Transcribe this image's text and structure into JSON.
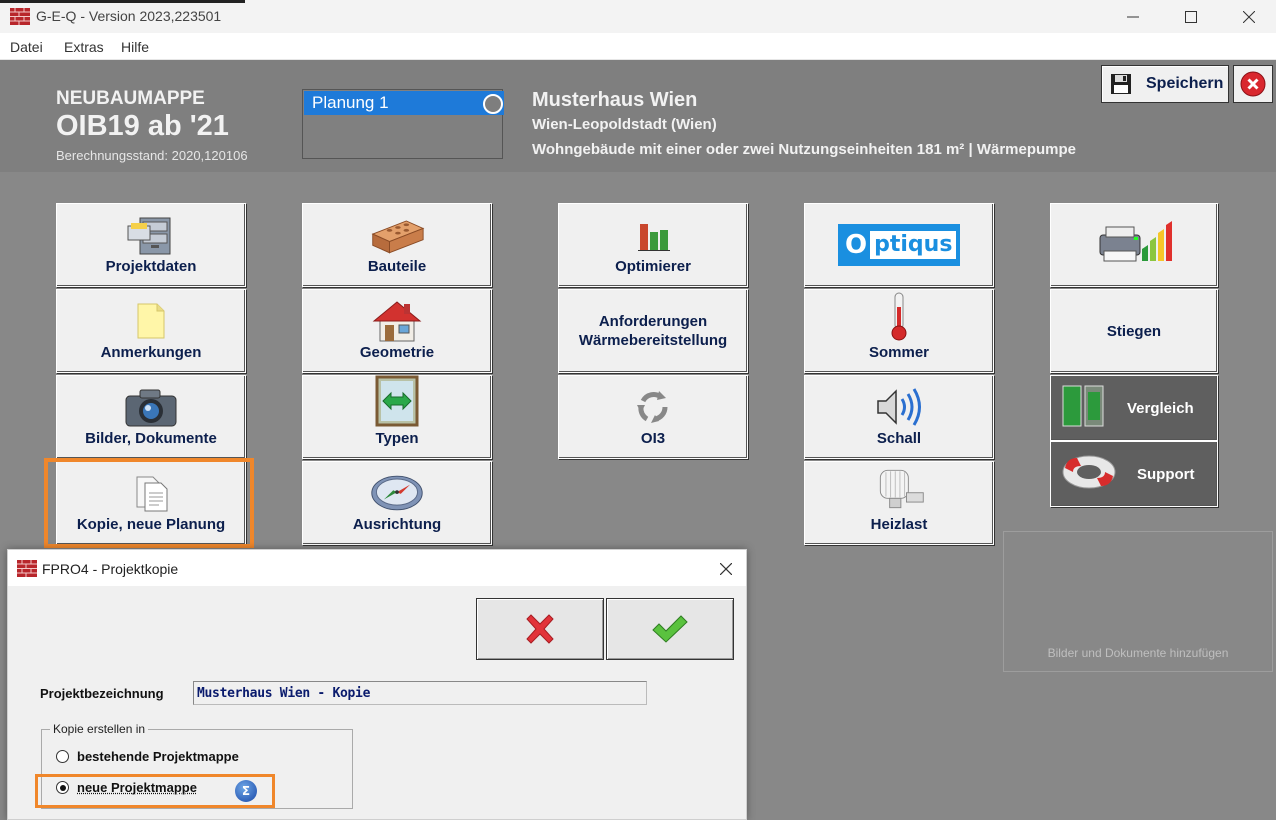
{
  "window": {
    "title": "G-E-Q - Version 2023,223501"
  },
  "menu": {
    "items": [
      "Datei",
      "Extras",
      "Hilfe"
    ]
  },
  "header": {
    "mappe_type": "NEUBAUMAPPE",
    "mappe_version": "OIB19 ab '21",
    "stand": "Berechnungsstand: 2020,120106",
    "planung": "Planung 1",
    "project_name": "Musterhaus Wien",
    "project_location": "Wien-Leopoldstadt (Wien)",
    "project_type": "Wohngebäude mit einer oder zwei Nutzungseinheiten  181 m²  |  Wärmepumpe"
  },
  "toolbar": {
    "save_label": "Speichern"
  },
  "tiles": {
    "projektdaten": "Projektdaten",
    "anmerkungen": "Anmerkungen",
    "bilder": "Bilder, Dokumente",
    "kopie": "Kopie, neue Planung",
    "bauteile": "Bauteile",
    "geometrie": "Geometrie",
    "typen": "Typen",
    "ausrichtung": "Ausrichtung",
    "optimierer": "Optimierer",
    "anforderungen_1": "Anforderungen",
    "anforderungen_2": "Wärmebereitstellung",
    "oi3": "OI3",
    "optiqus": "ptiqus",
    "optiqus_o": "O",
    "sommer": "Sommer",
    "schall": "Schall",
    "heizlast": "Heizlast",
    "stiegen": "Stiegen",
    "vergleich": "Vergleich",
    "support": "Support"
  },
  "drop_area": {
    "text": "Bilder und Dokumente hinzufügen"
  },
  "dialog": {
    "title": "FPRO4 - Projektkopie",
    "projekt_label": "Projektbezeichnung",
    "projekt_value": "Musterhaus Wien - Kopie",
    "group_label": "Kopie erstellen in",
    "option_bestehend": "bestehende Projektmappe",
    "option_neu": "neue Projektmappe",
    "selected": "neue Projektmappe"
  },
  "colors": {
    "accent_blue": "#1e7ad9",
    "highlight_orange": "#f0872b",
    "background_gray": "#888888"
  }
}
